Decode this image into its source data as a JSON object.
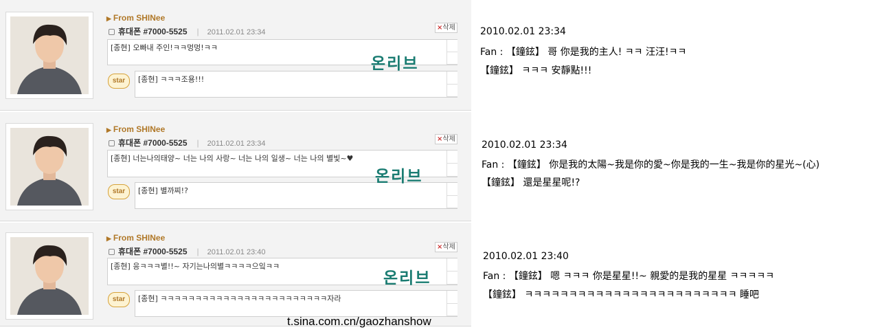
{
  "posts": [
    {
      "from": "From SHINee",
      "author": "휴대폰",
      "number": "#7000-5525",
      "date": "2011.02.01 23:34",
      "delete_label": "삭제",
      "comment": "[종현] 오빠내 주인!ㅋㅋ멍멍!ㅋㅋ",
      "star_label": "star",
      "reply": "[종현] ㅋㅋㅋ조용!!!",
      "watermark": "온리브"
    },
    {
      "from": "From SHINee",
      "author": "휴대폰",
      "number": "#7000-5525",
      "date": "2011.02.01 23:34",
      "delete_label": "삭제",
      "comment": "[종현] 너는나의태양~ 너는 나의 사랑~ 너는 나의 일생~ 너는 나의 별빛~♥",
      "star_label": "star",
      "reply": "[종현] 별까찌!?",
      "watermark": "온리브"
    },
    {
      "from": "From SHINee",
      "author": "휴대폰",
      "number": "#7000-5525",
      "date": "2011.02.01 23:40",
      "delete_label": "삭제",
      "comment": "[종현] 응ㅋㅋㅋ별!!~ 자기는나의별ㅋㅋㅋㅋ으잌ㅋㅋ",
      "star_label": "star",
      "reply": "[종현] ㅋㅋㅋㅋㅋㅋㅋㅋㅋㅋㅋㅋㅋㅋㅋㅋㅋㅋㅋㅋㅋㅋㅋㅋ자라",
      "watermark": "온리브"
    }
  ],
  "source": "t.sina.com.cn/gaozhanshow",
  "translations": [
    {
      "date": "2010.02.01 23:34",
      "fan": "Fan : 【鐘鉉】 哥 你是我的主人! ㅋㅋ 汪汪!ㅋㅋ",
      "reply": "【鐘鉉】 ㅋㅋㅋ 安靜點!!!"
    },
    {
      "date": "2010.02.01 23:34",
      "fan": "Fan : 【鐘鉉】 你是我的太陽~我是你的愛~你是我的一生~我是你的星光~(心)",
      "reply": "【鐘鉉】 還是星星呢!?"
    },
    {
      "date": "2010.02.01 23:40",
      "fan": "Fan : 【鐘鉉】 嗯 ㅋㅋㅋ 你是星星!!~ 親愛的是我的星星 ㅋㅋㅋㅋㅋ",
      "reply": "【鐘鉉】 ㅋㅋㅋㅋㅋㅋㅋㅋㅋㅋㅋㅋㅋㅋㅋㅋㅋㅋㅋㅋㅋㅋㅋㅋ 睡吧"
    }
  ],
  "colors": {
    "panel_bg": "#f3f3f3",
    "from_text": "#b07828",
    "watermark": "#1a7c72"
  },
  "icons": [
    "lock-icon",
    "delete-x-icon",
    "star-icon",
    "profile-photo"
  ]
}
